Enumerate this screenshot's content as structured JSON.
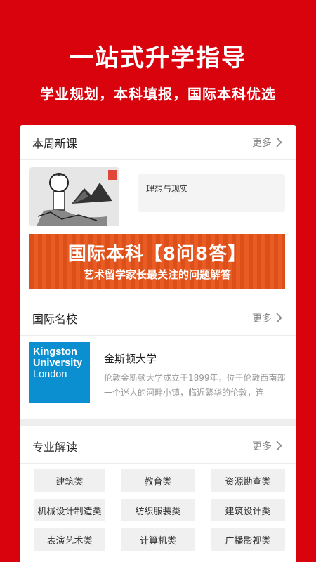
{
  "hero": {
    "title": "一站式升学指导",
    "subtitle": "学业规划，本科填报，国际本科优选"
  },
  "new_courses": {
    "title": "本周新课",
    "more": "更多",
    "course_title": "理想与现实"
  },
  "banner": {
    "title": "国际本科【8问8答】",
    "subtitle": "艺术留学家长最关注的问题解答"
  },
  "schools": {
    "title": "国际名校",
    "more": "更多",
    "logo_line1": "Kingston",
    "logo_line2": "University",
    "logo_line3": "London",
    "name": "金斯顿大学",
    "description": "伦敦金斯顿大学成立于1899年，位于伦敦西南部一个迷人的河畔小镇，临近繁华的伦敦，连"
  },
  "majors": {
    "title": "专业解读",
    "more": "更多",
    "items": [
      "建筑类",
      "教育类",
      "资源勘查类",
      "机械设计制造类",
      "纺织服装类",
      "建筑设计类",
      "表演艺术类",
      "计算机类",
      "广播影视类"
    ]
  },
  "colors": {
    "brand_red": "#d8030d",
    "banner_orange": "#e9551b",
    "school_blue": "#0b8fd1"
  }
}
